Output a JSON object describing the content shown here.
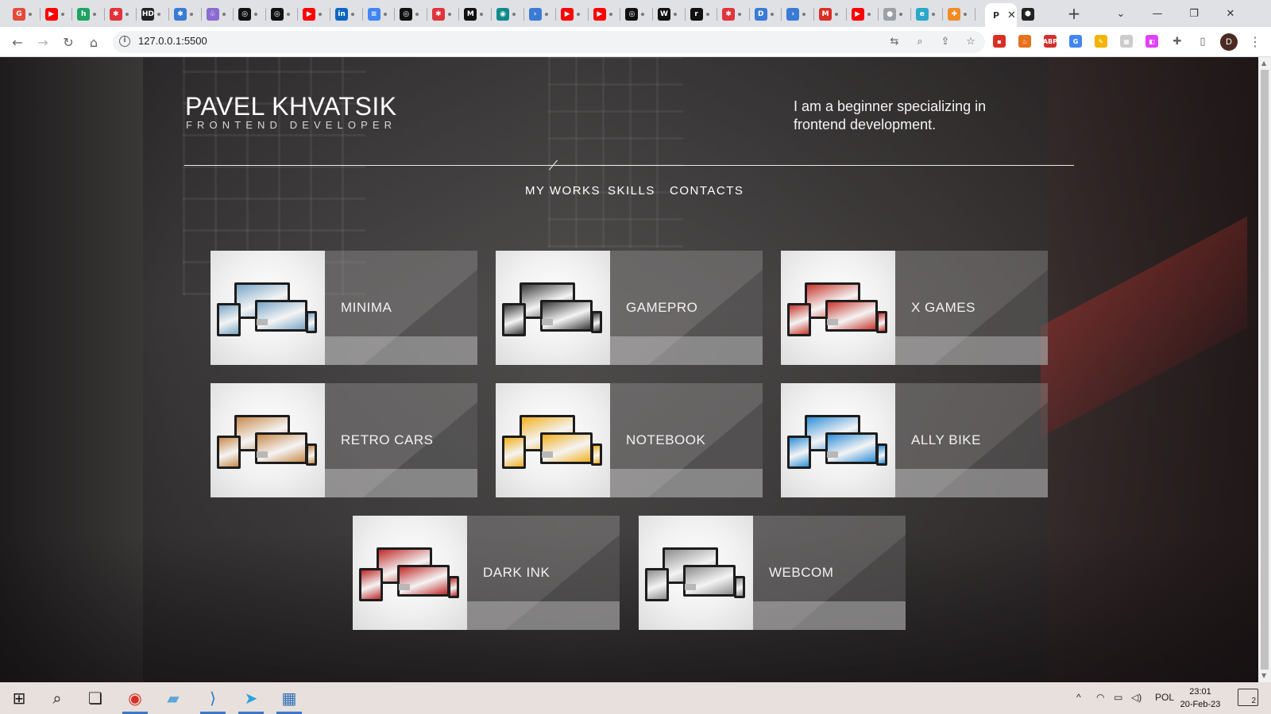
{
  "browser": {
    "active_tab": {
      "favicon_letter": "P",
      "close": "✕"
    },
    "new_tab": "+",
    "url": "127.0.0.1:5500",
    "window_controls": {
      "minimize": "—",
      "maximize": "❐",
      "close": "✕",
      "dropdown": "⌄"
    },
    "tabs": [
      {
        "favicon": "G",
        "color": "#e54a3b"
      },
      {
        "favicon": "▶",
        "color": "#ff0000"
      },
      {
        "favicon": "h",
        "color": "#1ea362"
      },
      {
        "favicon": "✱",
        "color": "#e0343c"
      },
      {
        "favicon": "HD",
        "color": "#222222"
      },
      {
        "favicon": "✱",
        "color": "#3a7bd5"
      },
      {
        "favicon": "♧",
        "color": "#8b6bd1"
      },
      {
        "favicon": "◎",
        "color": "#111111"
      },
      {
        "favicon": "◎",
        "color": "#111111"
      },
      {
        "favicon": "▶",
        "color": "#ff0000"
      },
      {
        "favicon": "in",
        "color": "#0a66c2"
      },
      {
        "favicon": "≡",
        "color": "#4285f4"
      },
      {
        "favicon": "◎",
        "color": "#111111"
      },
      {
        "favicon": "✱",
        "color": "#e0343c"
      },
      {
        "favicon": "M",
        "color": "#111111"
      },
      {
        "favicon": "◉",
        "color": "#0e8a8a"
      },
      {
        "favicon": "›",
        "color": "#3a7bd5"
      },
      {
        "favicon": "▶",
        "color": "#ff0000"
      },
      {
        "favicon": "▶",
        "color": "#ff0000"
      },
      {
        "favicon": "◎",
        "color": "#111111"
      },
      {
        "favicon": "W",
        "color": "#111111"
      },
      {
        "favicon": "r",
        "color": "#111111"
      },
      {
        "favicon": "✱",
        "color": "#e0343c"
      },
      {
        "favicon": "D",
        "color": "#3a7bd5"
      },
      {
        "favicon": "›",
        "color": "#3a7bd5"
      },
      {
        "favicon": "M",
        "color": "#d93025"
      },
      {
        "favicon": "▶",
        "color": "#ff0000"
      },
      {
        "favicon": "●",
        "color": "#9aa0a6"
      },
      {
        "favicon": "e",
        "color": "#2aa7c9"
      },
      {
        "favicon": "✚",
        "color": "#f28b24"
      }
    ],
    "extensions": [
      {
        "glyph": "▪",
        "color": "#d93025"
      },
      {
        "glyph": "♨",
        "color": "#e8711c"
      },
      {
        "glyph": "ABP",
        "color": "#d32f2f"
      },
      {
        "glyph": "G",
        "color": "#4285f4"
      },
      {
        "glyph": "✎",
        "color": "#f4b400"
      },
      {
        "glyph": "▦",
        "color": "#cccccc"
      },
      {
        "glyph": "◧",
        "color": "#e040fb"
      }
    ],
    "profile_initial": "D"
  },
  "site": {
    "name": "PAVEL KHVATSIK",
    "role": "FRONTEND DEVELOPER",
    "intro": "I am a beginner specializing in frontend development.",
    "nav": [
      "MY WORKS",
      "SKILLS",
      "CONTACTS"
    ],
    "projects": [
      {
        "title": "MINIMA",
        "accent": "#7aa6c7"
      },
      {
        "title": "GAMEPRO",
        "accent": "#3a3a3a"
      },
      {
        "title": "X GAMES",
        "accent": "#c8372d"
      },
      {
        "title": "RETRO CARS",
        "accent": "#c98a4b"
      },
      {
        "title": "NOTEBOOK",
        "accent": "#f2b01e"
      },
      {
        "title": "ALLY BIKE",
        "accent": "#2f8fd8"
      },
      {
        "title": "DARK INK",
        "accent": "#c02a2a"
      },
      {
        "title": "WEBCOM",
        "accent": "#8c8c8c"
      }
    ]
  },
  "taskbar": {
    "apps": [
      {
        "name": "start",
        "glyph": "⊞",
        "color": "#1b1b1b",
        "running": false
      },
      {
        "name": "search",
        "glyph": "⌕",
        "color": "#1b1b1b",
        "running": false
      },
      {
        "name": "task-view",
        "glyph": "❏",
        "color": "#1b1b1b",
        "running": false
      },
      {
        "name": "chrome",
        "glyph": "◉",
        "color": "#d93025",
        "running": true
      },
      {
        "name": "notepad",
        "glyph": "▰",
        "color": "#5ea7d8",
        "running": false
      },
      {
        "name": "vscode",
        "glyph": "⟩",
        "color": "#1e7acb",
        "running": true
      },
      {
        "name": "telegram",
        "glyph": "➤",
        "color": "#2aa3dd",
        "running": true
      },
      {
        "name": "calculator",
        "glyph": "▦",
        "color": "#2c6fb7",
        "running": true
      }
    ],
    "tray": {
      "chevron": "^",
      "language": "POL"
    },
    "time": "23:01",
    "date": "20-Feb-23",
    "notifications": "2"
  }
}
